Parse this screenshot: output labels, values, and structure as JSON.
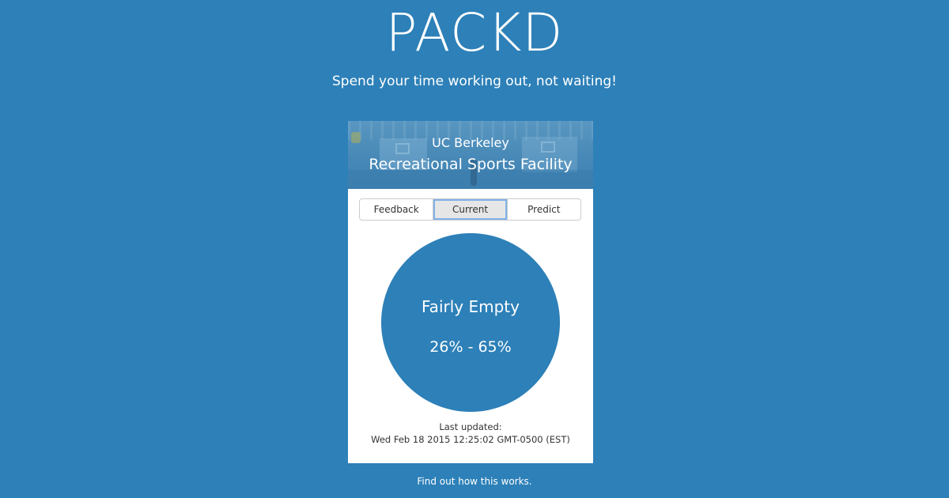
{
  "header": {
    "brand": "PACKD",
    "tagline": "Spend your time working out, not waiting!"
  },
  "facility": {
    "subtitle": "UC Berkeley",
    "title": "Recreational Sports Facility"
  },
  "tabs": [
    {
      "label": "Feedback",
      "active": false
    },
    {
      "label": "Current",
      "active": true
    },
    {
      "label": "Predict",
      "active": false
    }
  ],
  "status": {
    "label": "Fairly Empty",
    "range": "26% - 65%"
  },
  "updated": {
    "label": "Last updated:",
    "timestamp": "Wed Feb 18 2015 12:25:02 GMT-0500 (EST)"
  },
  "footer": {
    "link_text": "Find out how this works."
  },
  "colors": {
    "background": "#2d80b8",
    "gauge": "#2d80b8",
    "card": "#ffffff",
    "active_tab": "#e6e6e6"
  }
}
